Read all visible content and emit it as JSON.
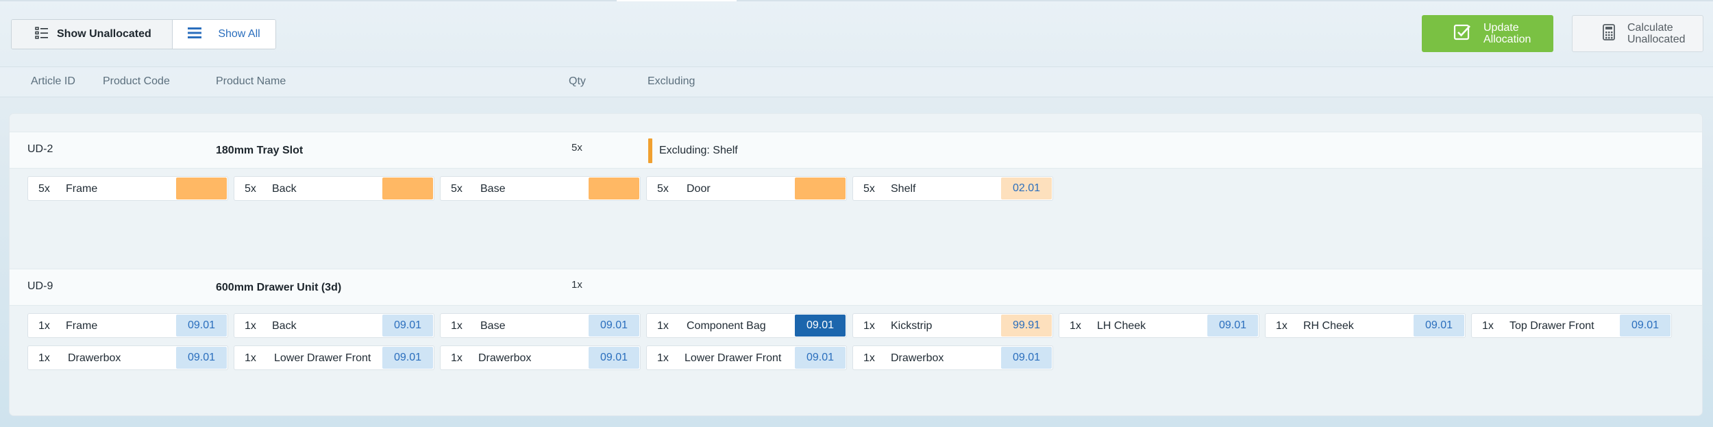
{
  "toolbar": {
    "show_unallocated": "Show Unallocated",
    "show_all": "Show All",
    "update_allocation": "Update\nAllocation",
    "calculate_unallocated": "Calculate\nUnallocated"
  },
  "columns": {
    "article_id": "Article ID",
    "product_code": "Product Code",
    "product_name": "Product Name",
    "qty": "Qty",
    "excluding": "Excluding"
  },
  "colors": {
    "accent_green": "#7ac143",
    "link_blue": "#2a6ebd",
    "tag_orange": "#ffb864",
    "tag_blue": "#cfe4f5",
    "tag_peach": "#fde0bd",
    "tag_dark": "#1c66ad"
  },
  "groups": [
    {
      "id": "UD-2",
      "name": "180mm Tray Slot",
      "qty": "5x",
      "excluding": "Excluding: Shelf",
      "items": [
        {
          "qty": "5x",
          "name": "Frame",
          "tag": "",
          "tag_style": "orange"
        },
        {
          "qty": "5x",
          "name": "Back",
          "tag": "",
          "tag_style": "orange"
        },
        {
          "qty": "5x",
          "name": "Base",
          "tag": "",
          "tag_style": "orange"
        },
        {
          "qty": "5x",
          "name": "Door",
          "tag": "",
          "tag_style": "orange"
        },
        {
          "qty": "5x",
          "name": "Shelf",
          "tag": "02.01",
          "tag_style": "peach"
        }
      ]
    },
    {
      "id": "UD-9",
      "name": "600mm Drawer Unit (3d)",
      "qty": "1x",
      "excluding": "",
      "items": [
        {
          "qty": "1x",
          "name": "Frame",
          "tag": "09.01",
          "tag_style": "blue"
        },
        {
          "qty": "1x",
          "name": "Back",
          "tag": "09.01",
          "tag_style": "blue"
        },
        {
          "qty": "1x",
          "name": "Base",
          "tag": "09.01",
          "tag_style": "blue"
        },
        {
          "qty": "1x",
          "name": "Component Bag",
          "tag": "09.01",
          "tag_style": "dark"
        },
        {
          "qty": "1x",
          "name": "Kickstrip",
          "tag": "99.91",
          "tag_style": "peach"
        },
        {
          "qty": "1x",
          "name": "LH Cheek",
          "tag": "09.01",
          "tag_style": "blue"
        },
        {
          "qty": "1x",
          "name": "RH Cheek",
          "tag": "09.01",
          "tag_style": "blue"
        },
        {
          "qty": "1x",
          "name": "Top Drawer Front",
          "tag": "09.01",
          "tag_style": "blue"
        },
        {
          "qty": "1x",
          "name": "Drawerbox",
          "tag": "09.01",
          "tag_style": "blue"
        },
        {
          "qty": "1x",
          "name": "Lower Drawer Front",
          "tag": "09.01",
          "tag_style": "blue"
        },
        {
          "qty": "1x",
          "name": "Drawerbox",
          "tag": "09.01",
          "tag_style": "blue"
        },
        {
          "qty": "1x",
          "name": "Lower Drawer Front",
          "tag": "09.01",
          "tag_style": "blue"
        },
        {
          "qty": "1x",
          "name": "Drawerbox",
          "tag": "09.01",
          "tag_style": "blue"
        }
      ]
    }
  ]
}
